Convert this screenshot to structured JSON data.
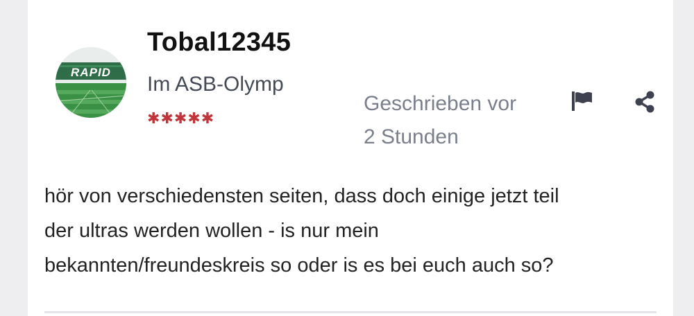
{
  "post": {
    "author": {
      "username": "Tobal12345",
      "rank_title": "Im ASB-Olymp",
      "rank_stars": 5,
      "avatar_text": "RAPID"
    },
    "posted_label_line1": "Geschrieben vor",
    "posted_label_line2": "2 Stunden",
    "actions": {
      "report_icon": "flag-icon",
      "share_icon": "share-icon"
    },
    "content_lines": [
      "hör von verschiedensten seiten, dass doch einige jetzt teil",
      "der ultras werden wollen - is nur mein",
      "bekannten/freundeskreis so oder is es bei euch auch so?"
    ]
  },
  "colors": {
    "page_background": "#eeeef1",
    "card_background": "#ffffff",
    "username": "#111111",
    "meta_text": "#7a7f8c",
    "star": "#c0343a",
    "action_icon": "#3d4150",
    "avatar_green": "#2f8a3e"
  }
}
